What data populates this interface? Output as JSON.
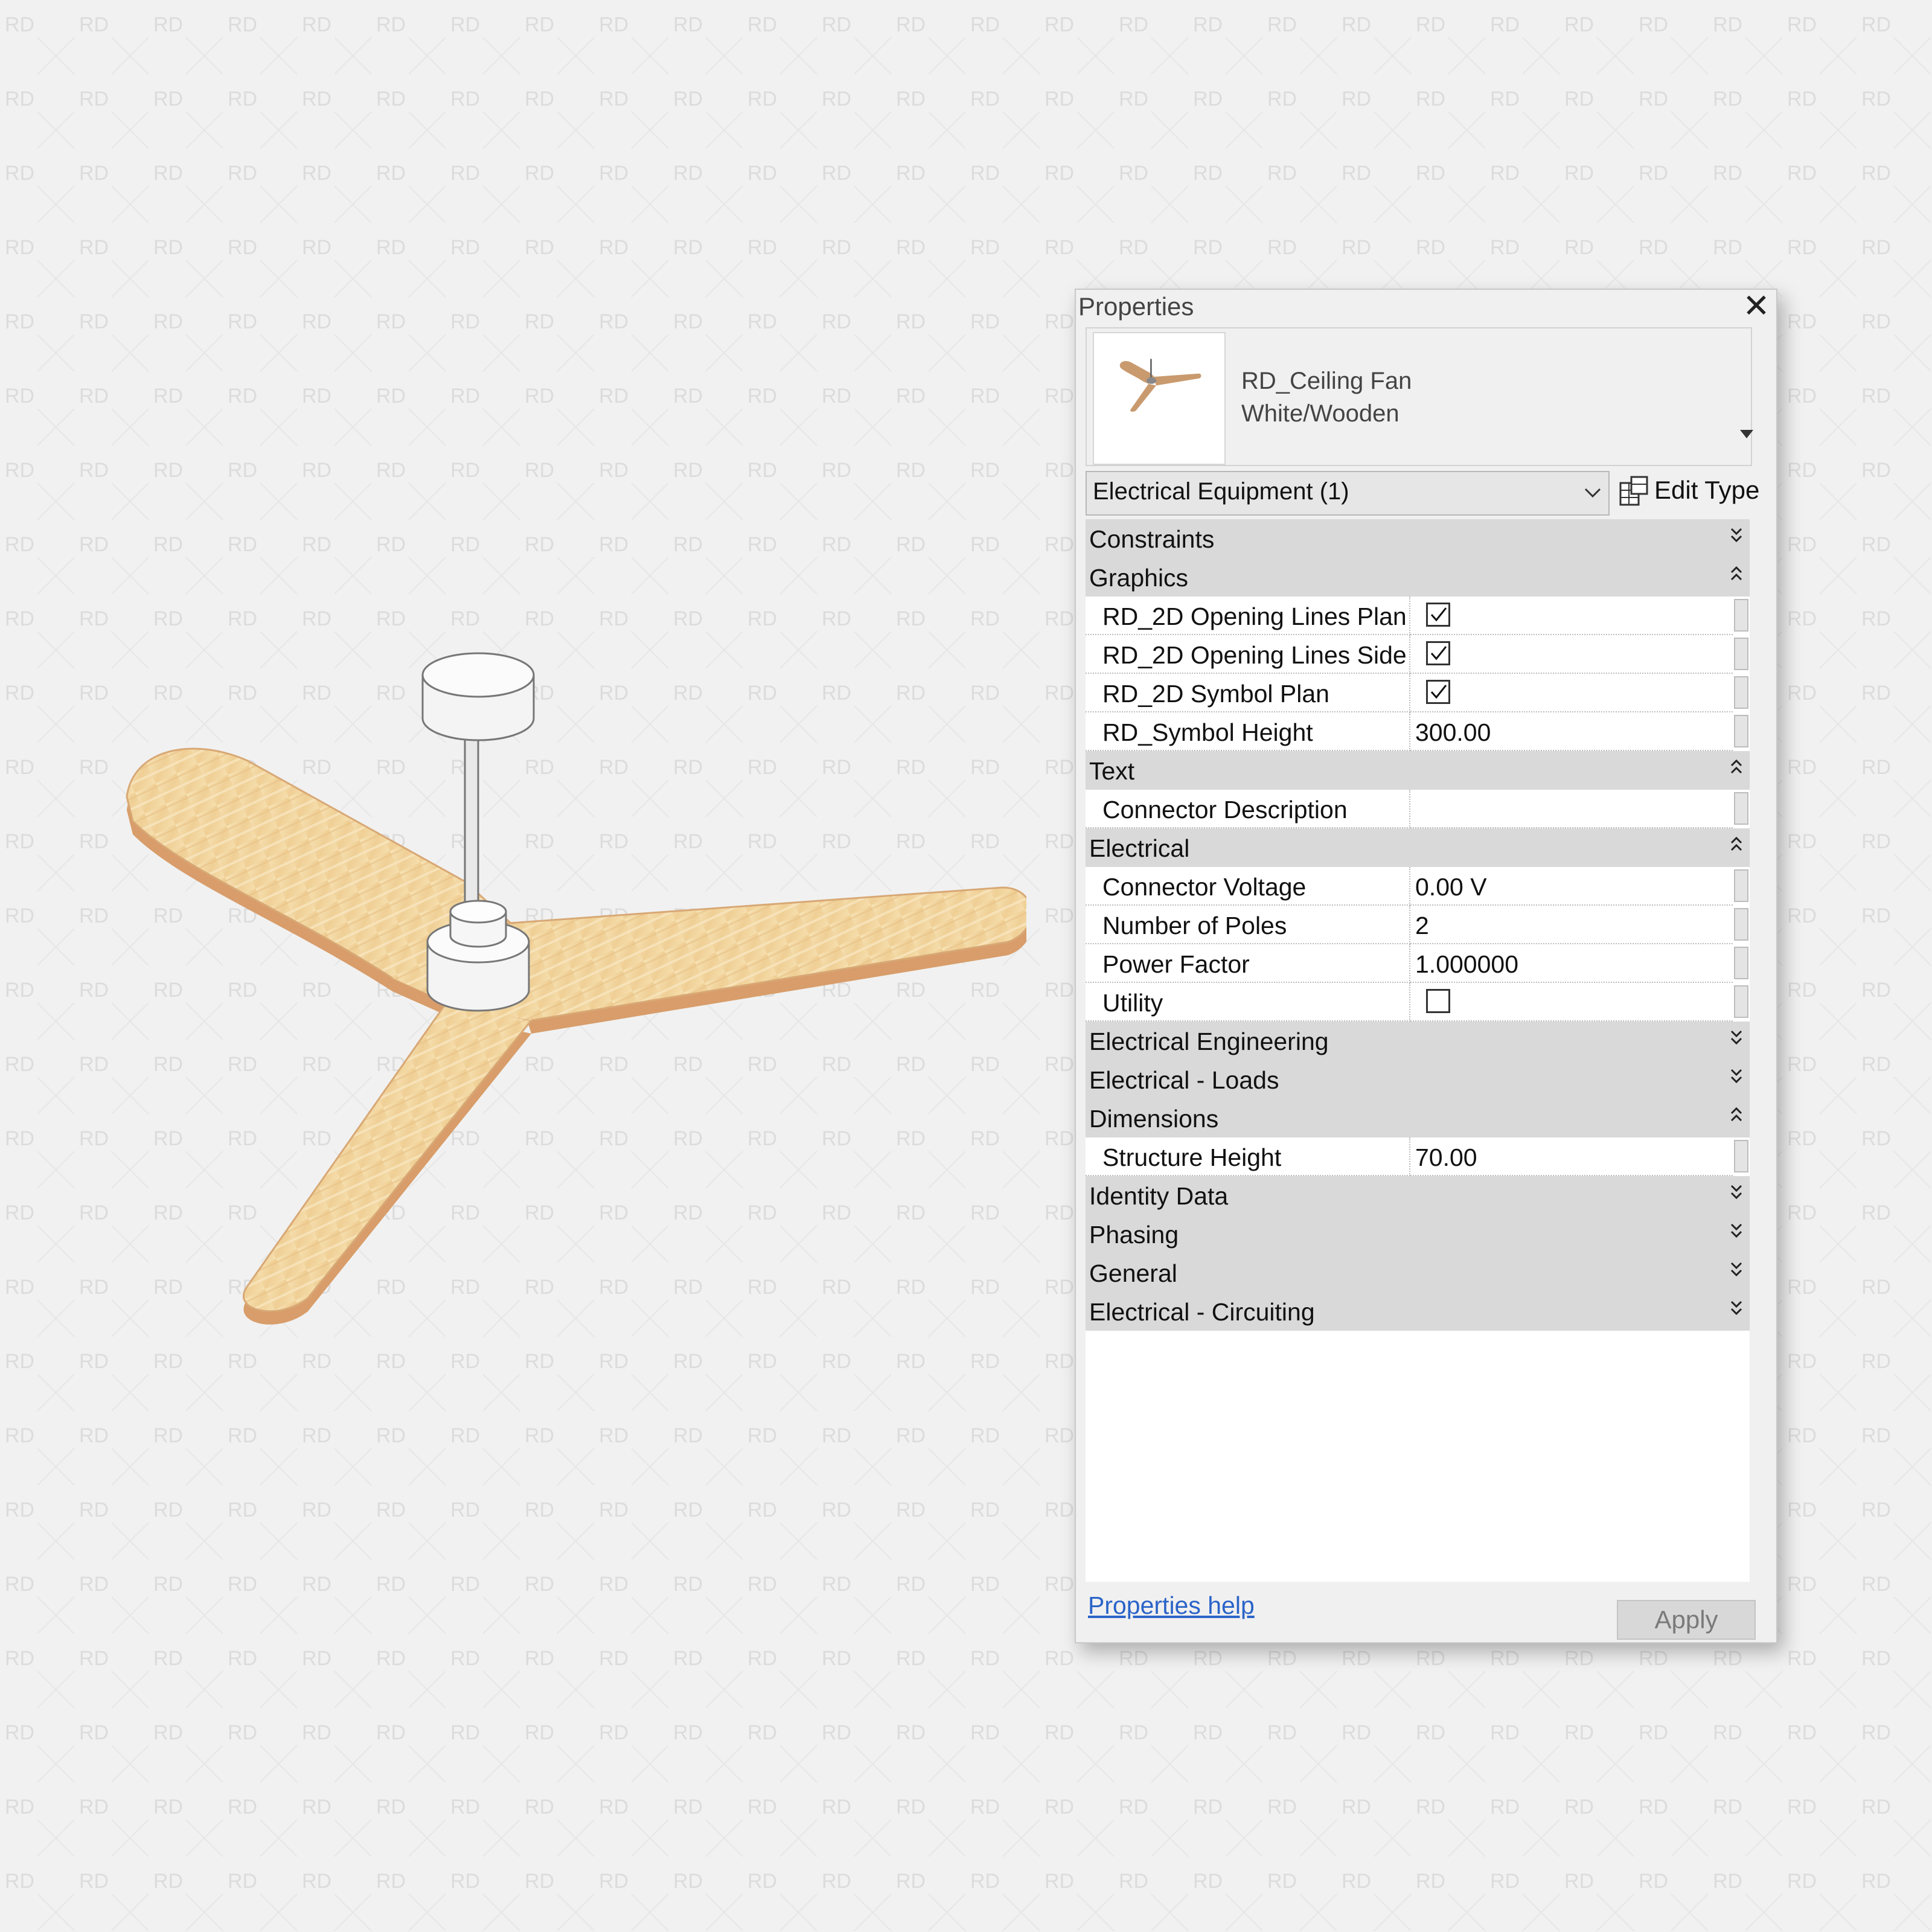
{
  "watermark": "RD",
  "panel": {
    "title": "Properties",
    "type_selector": {
      "family": "RD_Ceiling Fan",
      "type": "White/Wooden"
    },
    "filter": "Electrical Equipment (1)",
    "edit_type_label": "Edit Type",
    "groups": [
      {
        "label": "Constraints",
        "state": "collapsed",
        "rows": []
      },
      {
        "label": "Graphics",
        "state": "expanded",
        "rows": [
          {
            "name": "RD_2D Opening Lines Plan",
            "kind": "checkbox",
            "checked": true
          },
          {
            "name": "RD_2D Opening Lines Side",
            "kind": "checkbox",
            "checked": true
          },
          {
            "name": "RD_2D Symbol Plan",
            "kind": "checkbox",
            "checked": true
          },
          {
            "name": "RD_Symbol Height",
            "kind": "text",
            "value": "300.00"
          }
        ]
      },
      {
        "label": "Text",
        "state": "expanded",
        "rows": [
          {
            "name": "Connector Description",
            "kind": "text",
            "value": ""
          }
        ]
      },
      {
        "label": "Electrical",
        "state": "expanded",
        "rows": [
          {
            "name": "Connector Voltage",
            "kind": "text",
            "value": "0.00 V"
          },
          {
            "name": "Number of Poles",
            "kind": "text",
            "value": "2"
          },
          {
            "name": "Power Factor",
            "kind": "text",
            "value": "1.000000"
          },
          {
            "name": "Utility",
            "kind": "checkbox",
            "checked": false
          }
        ]
      },
      {
        "label": "Electrical Engineering",
        "state": "collapsed",
        "rows": []
      },
      {
        "label": "Electrical - Loads",
        "state": "collapsed",
        "rows": []
      },
      {
        "label": "Dimensions",
        "state": "expanded",
        "rows": [
          {
            "name": "Structure Height",
            "kind": "text",
            "value": "70.00"
          }
        ]
      },
      {
        "label": "Identity Data",
        "state": "collapsed",
        "rows": []
      },
      {
        "label": "Phasing",
        "state": "collapsed",
        "rows": []
      },
      {
        "label": "General",
        "state": "collapsed",
        "rows": []
      },
      {
        "label": "Electrical - Circuiting",
        "state": "collapsed",
        "rows": []
      }
    ],
    "help_link": "Properties help",
    "apply_label": "Apply"
  },
  "icons": {
    "close": "close-icon",
    "dropdown": "chevron-down-icon",
    "edit_type": "edit-type-icon",
    "expand": "double-chevron-down-icon",
    "collapse": "double-chevron-up-icon",
    "check": "checkmark-icon"
  },
  "colors": {
    "background": "#f1f1f1",
    "group_header": "#d9d9d9",
    "link": "#2a64c8",
    "wood": "#f2d6a0",
    "wood_edge": "#d89d6a"
  }
}
